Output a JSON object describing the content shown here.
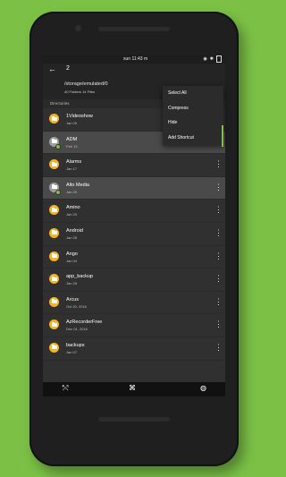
{
  "status_bar": {
    "time": "sun 11:43 m",
    "icons": [
      "ad-icon",
      "bluetooth-icon",
      "battery-icon"
    ]
  },
  "appbar": {
    "back_label": "←",
    "selected_count": "2",
    "path": "/storage/emulated/0",
    "subpath": "40 Folders 14 Files"
  },
  "section": {
    "title": "Directories"
  },
  "menu": {
    "items": [
      {
        "label": "Select All"
      },
      {
        "label": "Compress"
      },
      {
        "label": "Hide"
      },
      {
        "label": "Add Shortcut"
      }
    ]
  },
  "list": {
    "items": [
      {
        "name": "1Videoshow",
        "date": "Jan 09",
        "selected": false,
        "icon": "folder-icon"
      },
      {
        "name": "ADM",
        "date": "Feb 13",
        "selected": true,
        "icon": "folder-icon"
      },
      {
        "name": "Alarms",
        "date": "Jan 17",
        "selected": false,
        "icon": "folder-icon"
      },
      {
        "name": "Alto Media",
        "date": "Jan 29",
        "selected": true,
        "icon": "folder-icon"
      },
      {
        "name": "Amino",
        "date": "Jan 29",
        "selected": false,
        "icon": "folder-icon"
      },
      {
        "name": "Android",
        "date": "Jan 28",
        "selected": false,
        "icon": "folder-icon"
      },
      {
        "name": "Ango",
        "date": "Jan 04",
        "selected": false,
        "icon": "folder-icon"
      },
      {
        "name": "app_backup",
        "date": "Jan 28",
        "selected": false,
        "icon": "folder-icon"
      },
      {
        "name": "Arcus",
        "date": "Oct 20, 2016",
        "selected": false,
        "icon": "folder-icon"
      },
      {
        "name": "AzRecorderFree",
        "date": "Dec 01, 2016",
        "selected": false,
        "icon": "folder-icon"
      },
      {
        "name": "backups",
        "date": "Jan 07",
        "selected": false,
        "icon": "folder-icon"
      }
    ]
  },
  "bottom_bar": {
    "left_icon": "swipe-icon",
    "center_icon": "app-icon",
    "right_icon": "disc-icon"
  },
  "colors": {
    "background": "#7cc146",
    "accent": "#f5b325",
    "selected_row": "#4a4a4a"
  }
}
